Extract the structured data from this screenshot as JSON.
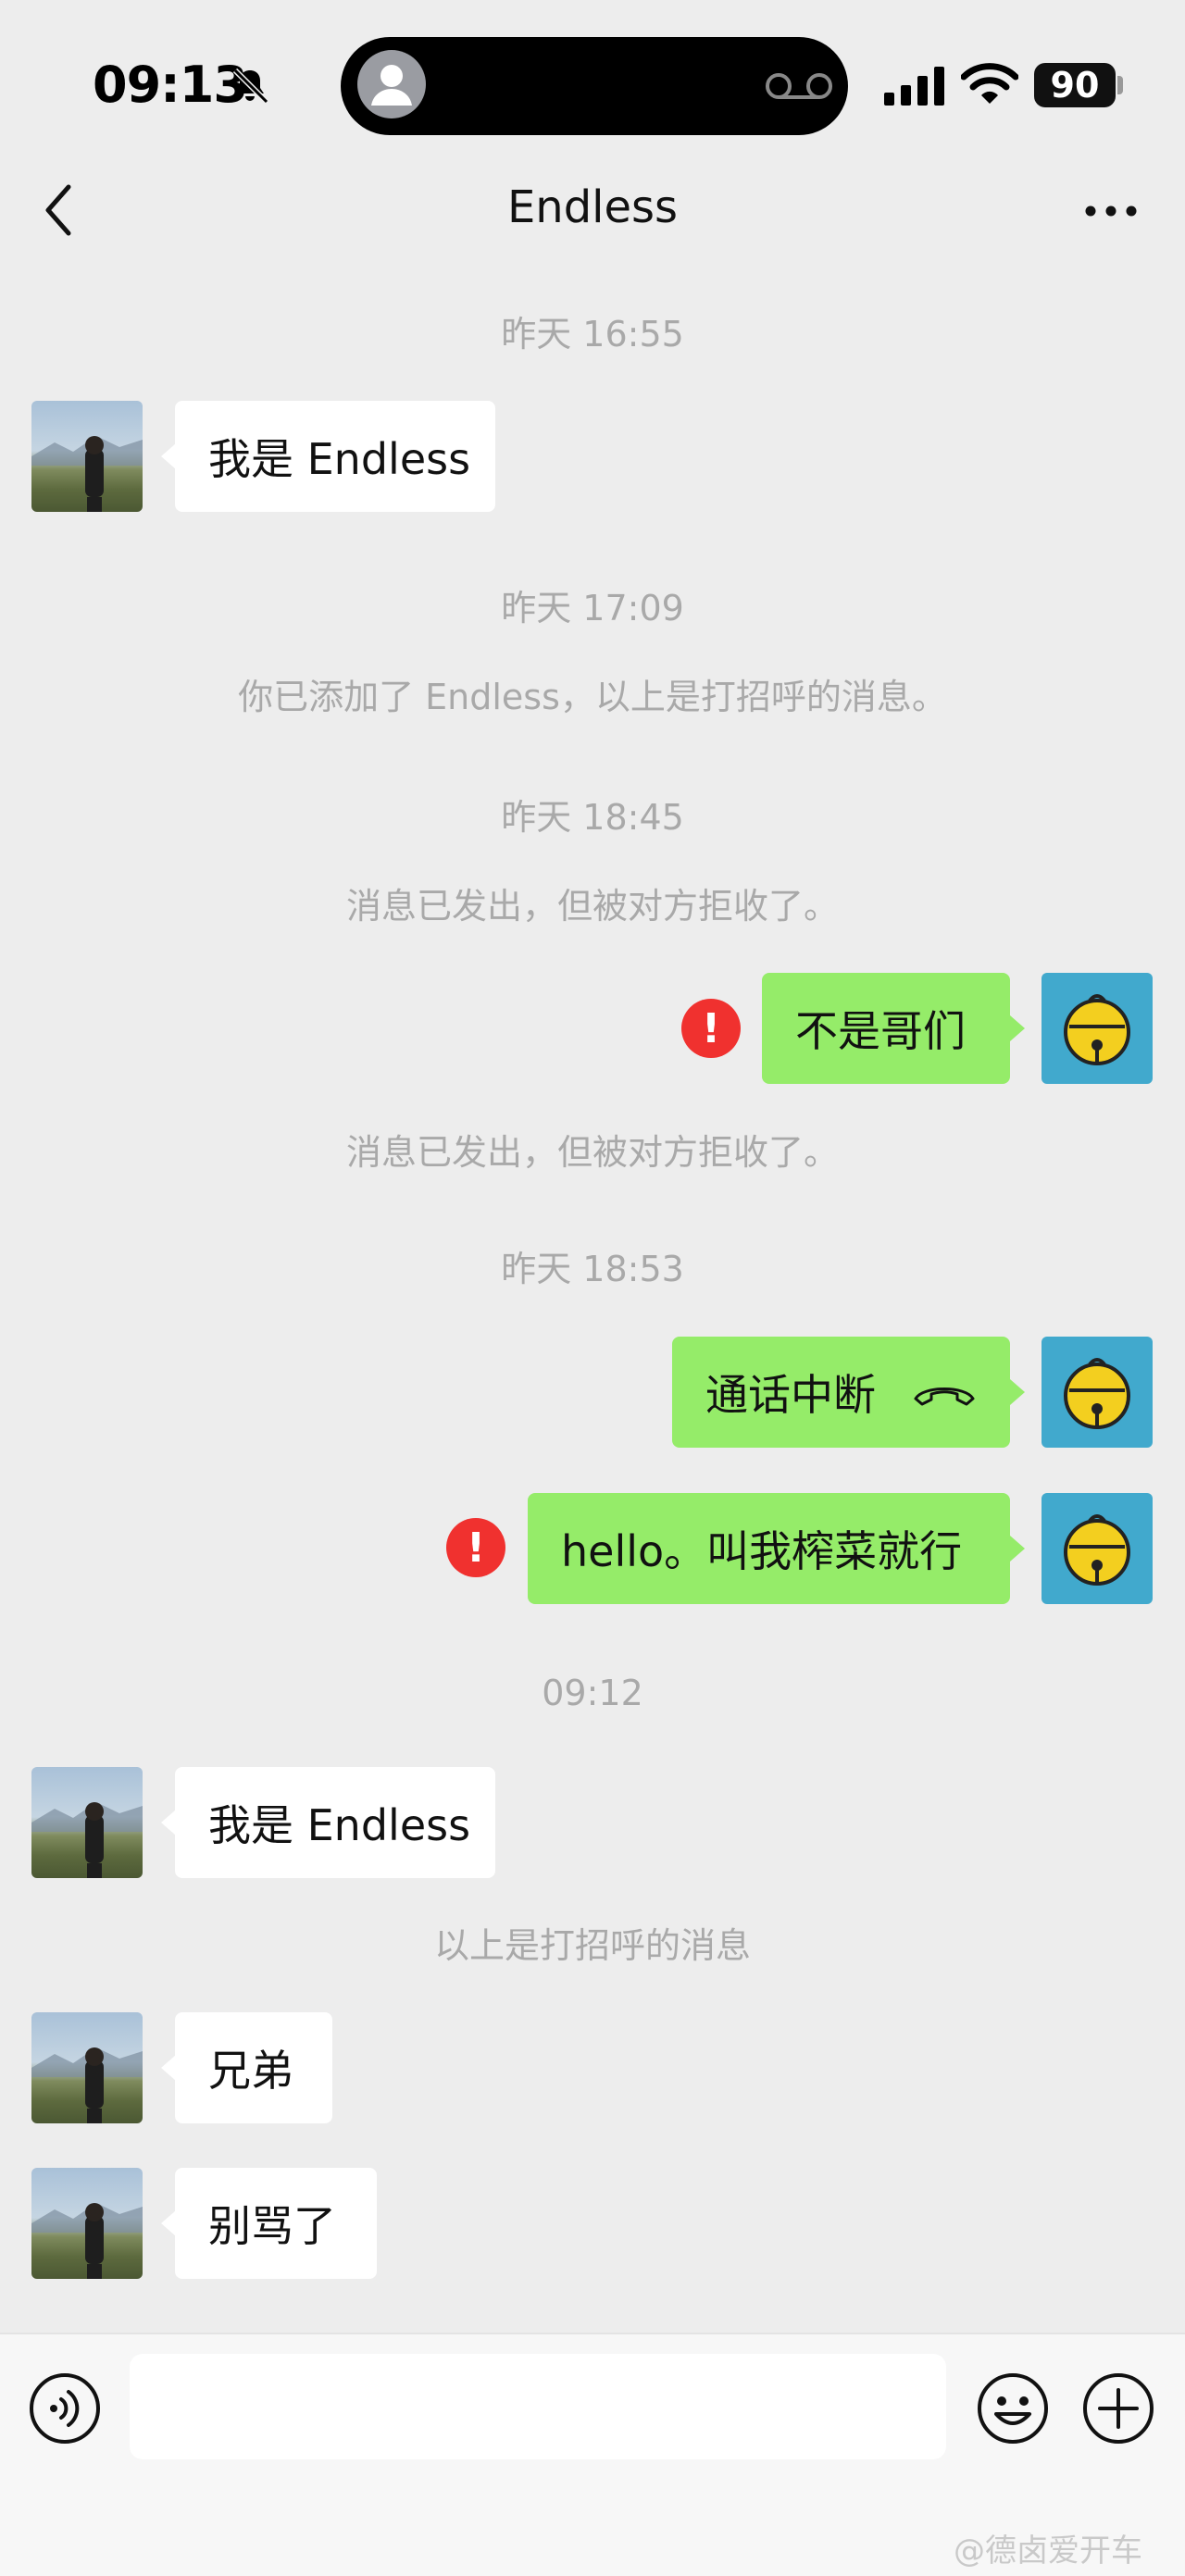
{
  "status_bar": {
    "time": "09:13",
    "battery": "90"
  },
  "nav": {
    "title": "Endless"
  },
  "messages": {
    "ts1": "昨天 16:55",
    "m1": "我是 Endless",
    "ts2": "昨天 17:09",
    "sys1": "你已添加了 Endless，以上是打招呼的消息。",
    "ts3": "昨天 18:45",
    "sys2": "消息已发出，但被对方拒收了。",
    "m2": "不是哥们",
    "sys3": "消息已发出，但被对方拒收了。",
    "ts4": "昨天 18:53",
    "m3": "通话中断",
    "m4": "hello。叫我榨菜就行",
    "ts5": "09:12",
    "m5": "我是 Endless",
    "sys4": "以上是打招呼的消息",
    "m6": "兄弟",
    "m7": "别骂了"
  },
  "error_mark": "!",
  "input": {
    "placeholder": ""
  },
  "watermark": "@德卤爱开车",
  "colors": {
    "background": "#ededed",
    "outgoing_bubble": "#95ec69",
    "incoming_bubble": "#ffffff",
    "error": "#f0312f",
    "self_avatar_bg": "#41a9cd"
  },
  "icons": [
    "bell-slash-icon",
    "voicemail-icon",
    "signal-icon",
    "wifi-icon",
    "back-chevron-icon",
    "more-dots-icon",
    "call-end-icon",
    "voice-input-icon",
    "emoji-icon",
    "plus-icon"
  ]
}
